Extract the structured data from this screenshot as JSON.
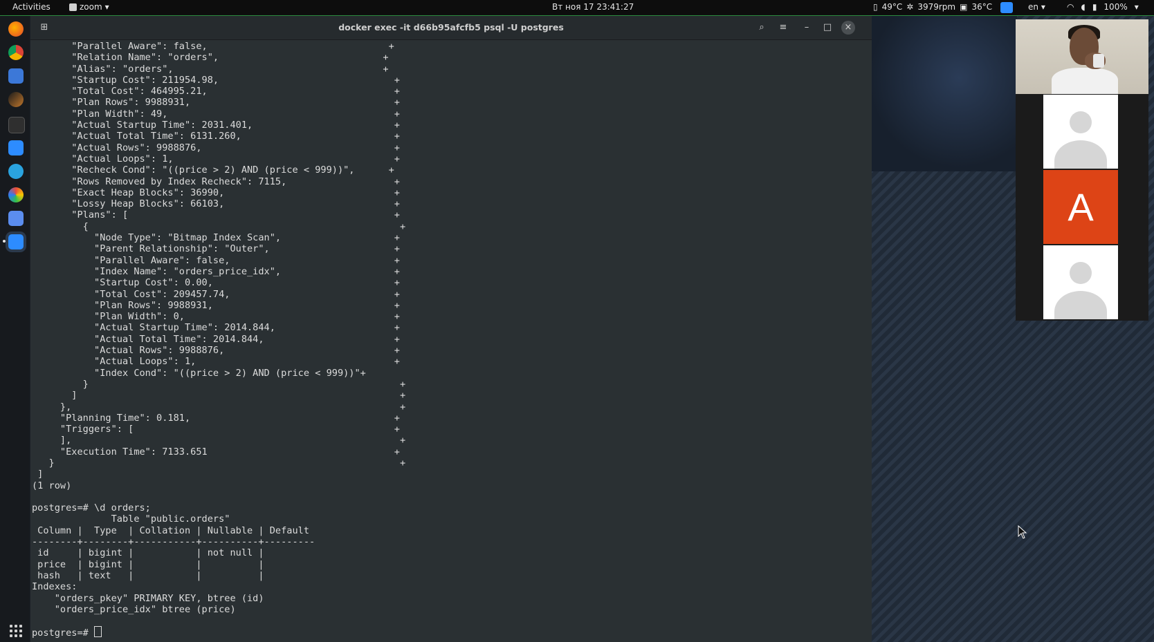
{
  "topbar": {
    "activities": "Activities",
    "app_name": "zoom",
    "datetime": "Вт ноя 17  23:41:27",
    "cpu_temp": "49°C",
    "fan": "3979rpm",
    "gpu_temp": "36°C",
    "language": "en",
    "battery": "100%"
  },
  "dock": {
    "items": [
      "firefox-icon",
      "chrome-icon",
      "text-editor-icon",
      "feather-icon",
      "terminal-icon",
      "zoom-icon",
      "telegram-icon",
      "color-picker-icon",
      "notes-icon",
      "zoom-active-icon"
    ]
  },
  "terminal": {
    "title": "docker exec -it d66b95afcfb5 psql -U postgres",
    "lines": [
      "       \"Parallel Aware\": false,                                +",
      "       \"Relation Name\": \"orders\",                             +",
      "       \"Alias\": \"orders\",                                     +",
      "       \"Startup Cost\": 211954.98,                               +",
      "       \"Total Cost\": 464995.21,                                 +",
      "       \"Plan Rows\": 9988931,                                    +",
      "       \"Plan Width\": 49,                                        +",
      "       \"Actual Startup Time\": 2031.401,                         +",
      "       \"Actual Total Time\": 6131.260,                           +",
      "       \"Actual Rows\": 9988876,                                  +",
      "       \"Actual Loops\": 1,                                       +",
      "       \"Recheck Cond\": \"((price > 2) AND (price < 999))\",      +",
      "       \"Rows Removed by Index Recheck\": 7115,                   +",
      "       \"Exact Heap Blocks\": 36990,                              +",
      "       \"Lossy Heap Blocks\": 66103,                              +",
      "       \"Plans\": [                                               +",
      "         {                                                       +",
      "           \"Node Type\": \"Bitmap Index Scan\",                    +",
      "           \"Parent Relationship\": \"Outer\",                      +",
      "           \"Parallel Aware\": false,                             +",
      "           \"Index Name\": \"orders_price_idx\",                    +",
      "           \"Startup Cost\": 0.00,                                +",
      "           \"Total Cost\": 209457.74,                             +",
      "           \"Plan Rows\": 9988931,                                +",
      "           \"Plan Width\": 0,                                     +",
      "           \"Actual Startup Time\": 2014.844,                     +",
      "           \"Actual Total Time\": 2014.844,                       +",
      "           \"Actual Rows\": 9988876,                              +",
      "           \"Actual Loops\": 1,                                   +",
      "           \"Index Cond\": \"((price > 2) AND (price < 999))\"+",
      "         }                                                       +",
      "       ]                                                         +",
      "     },                                                          +",
      "     \"Planning Time\": 0.181,                                    +",
      "     \"Triggers\": [                                              +",
      "     ],                                                          +",
      "     \"Execution Time\": 7133.651                                 +",
      "   }                                                             +",
      " ]",
      "(1 row)",
      "",
      "postgres=# \\d orders;",
      "              Table \"public.orders\"",
      " Column |  Type  | Collation | Nullable | Default",
      "--------+--------+-----------+----------+---------",
      " id     | bigint |           | not null |",
      " price  | bigint |           |          |",
      " hash   | text   |           |          |",
      "Indexes:",
      "    \"orders_pkey\" PRIMARY KEY, btree (id)",
      "    \"orders_price_idx\" btree (price)",
      ""
    ],
    "prompt": "postgres=# "
  },
  "zoom_panel": {
    "participant_letter": "A",
    "letter_color": "#dd4416"
  }
}
